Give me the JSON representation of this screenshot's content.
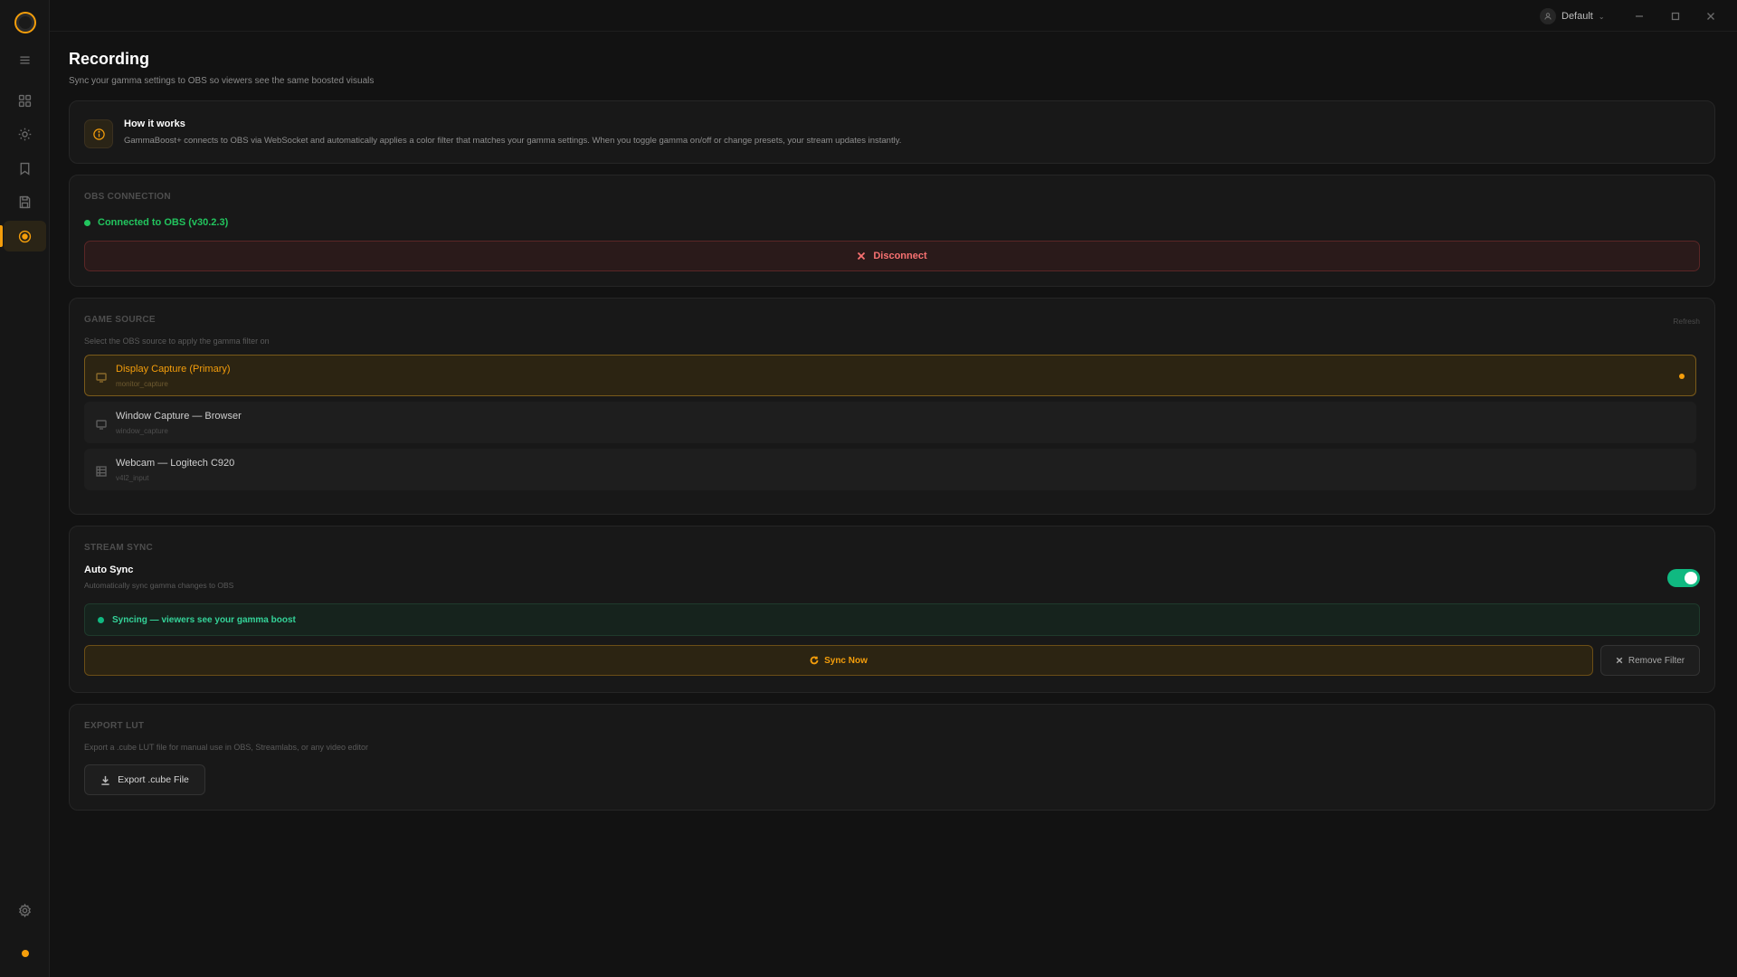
{
  "app": {
    "profile_name": "Default"
  },
  "page": {
    "title": "Recording",
    "subtitle": "Sync your gamma settings to OBS so viewers see the same boosted visuals"
  },
  "how_it_works": {
    "title": "How it works",
    "text": "GammaBoost+ connects to OBS via WebSocket and automatically applies a color filter that matches your gamma settings. When you toggle gamma on/off or change presets, your stream updates instantly."
  },
  "obs_connection": {
    "label": "OBS CONNECTION",
    "status": "Connected to OBS (v30.2.3)",
    "disconnect_label": "Disconnect"
  },
  "game_source": {
    "label": "GAME SOURCE",
    "refresh_label": "Refresh",
    "hint": "Select the OBS source to apply the gamma filter on",
    "sources": [
      {
        "name": "Display Capture (Primary)",
        "id": "monitor_capture",
        "icon": "monitor-icon",
        "selected": true
      },
      {
        "name": "Window Capture — Browser",
        "id": "window_capture",
        "icon": "monitor-icon",
        "selected": false
      },
      {
        "name": "Webcam — Logitech C920",
        "id": "v4l2_input",
        "icon": "grid-icon",
        "selected": false
      }
    ]
  },
  "stream_sync": {
    "label": "STREAM SYNC",
    "auto_sync_title": "Auto Sync",
    "auto_sync_desc": "Automatically sync gamma changes to OBS",
    "auto_sync_enabled": true,
    "status_text": "Syncing — viewers see your gamma boost",
    "sync_now_label": "Sync Now",
    "remove_filter_label": "Remove Filter"
  },
  "export_lut": {
    "label": "EXPORT LUT",
    "hint": "Export a .cube LUT file for manual use in OBS, Streamlabs, or any video editor",
    "button_label": "Export .cube File"
  },
  "colors": {
    "accent": "#f59e0b",
    "success": "#22c55e",
    "danger": "#f87171",
    "background": "#121212"
  }
}
